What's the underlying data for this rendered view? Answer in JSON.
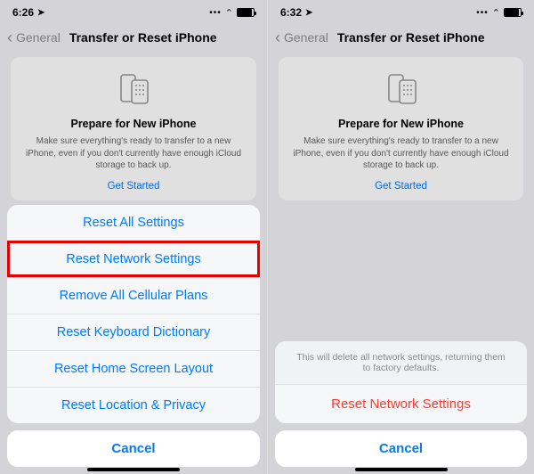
{
  "left": {
    "status": {
      "time": "6:26",
      "battery_pct": 90
    },
    "nav": {
      "back": "General",
      "title": "Transfer or Reset iPhone"
    },
    "card": {
      "title": "Prepare for New iPhone",
      "body": "Make sure everything's ready to transfer to a new iPhone, even if you don't currently have enough iCloud storage to back up.",
      "cta": "Get Started"
    },
    "sheet": {
      "items": [
        "Reset All Settings",
        "Reset Network Settings",
        "Remove All Cellular Plans",
        "Reset Keyboard Dictionary",
        "Reset Home Screen Layout",
        "Reset Location & Privacy"
      ],
      "cancel": "Cancel",
      "highlighted_index": 1
    }
  },
  "right": {
    "status": {
      "time": "6:32",
      "battery_pct": 90
    },
    "nav": {
      "back": "General",
      "title": "Transfer or Reset iPhone"
    },
    "card": {
      "title": "Prepare for New iPhone",
      "body": "Make sure everything's ready to transfer to a new iPhone, even if you don't currently have enough iCloud storage to back up.",
      "cta": "Get Started"
    },
    "confirm": {
      "message": "This will delete all network settings, returning them to factory defaults.",
      "action": "Reset Network Settings",
      "cancel": "Cancel"
    }
  },
  "colors": {
    "accent": "#007aff",
    "destructive": "#ff3b30",
    "highlight": "#e60000"
  }
}
